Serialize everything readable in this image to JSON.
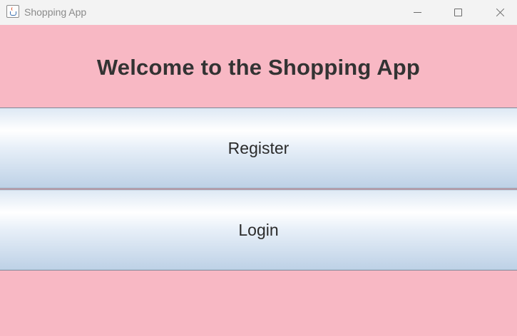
{
  "window": {
    "title": "Shopping App",
    "icon": "java-cup-icon",
    "controls": [
      "minimize-icon",
      "maximize-icon",
      "close-icon"
    ]
  },
  "main": {
    "heading": "Welcome to the Shopping App",
    "register_label": "Register",
    "login_label": "Login"
  },
  "colors": {
    "background": "#f8b8c4",
    "heading_text": "#333333",
    "button_gradient_top": "#ffffff",
    "button_gradient_bottom": "#bdd1e6"
  }
}
